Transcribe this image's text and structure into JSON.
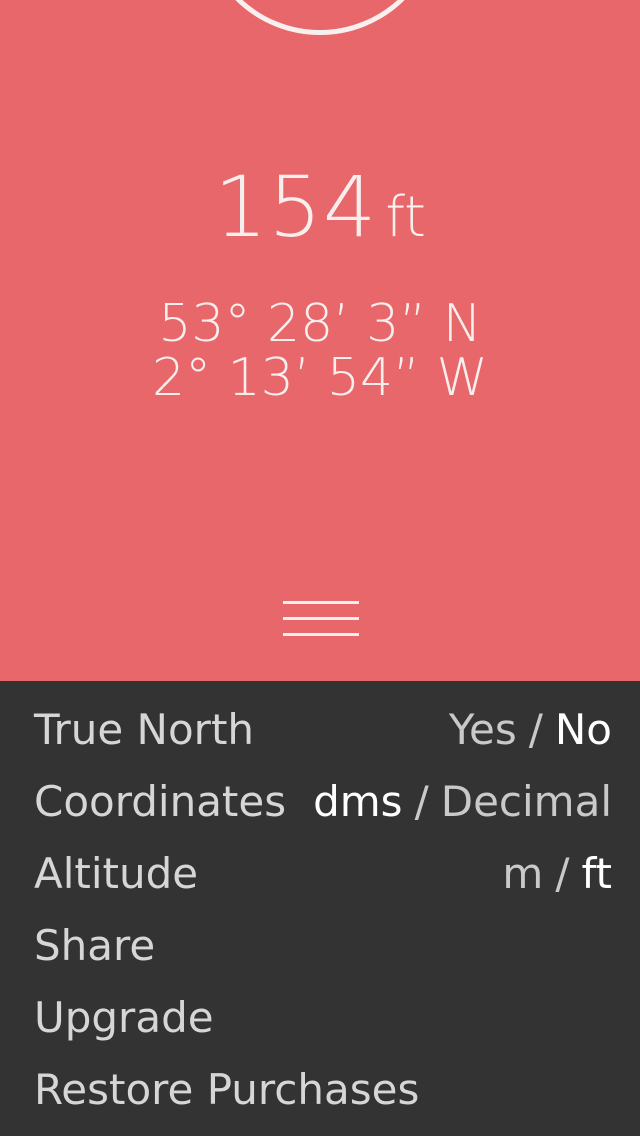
{
  "altitude": {
    "value": "154",
    "unit": "ft"
  },
  "coordinates": {
    "latitude": "53° 28’ 3” N",
    "longitude": "2° 13’ 54” W"
  },
  "menu_icon": "hamburger-menu-icon",
  "colors": {
    "accent": "#E8676A",
    "panel": "#333333",
    "text_light": "#F7EEEE",
    "option_active": "#FFFFFF",
    "option_inactive": "#C9C9C9"
  },
  "settings": {
    "true_north": {
      "label": "True North",
      "option_a": "Yes",
      "separator": "/",
      "option_b": "No",
      "selected": "No"
    },
    "coordinates": {
      "label": "Coordinates",
      "option_a": "dms",
      "separator": "/",
      "option_b": "Decimal",
      "selected": "dms"
    },
    "altitude": {
      "label": "Altitude",
      "option_a": "m",
      "separator": "/",
      "option_b": "ft",
      "selected": "ft"
    },
    "share": {
      "label": "Share"
    },
    "upgrade": {
      "label": "Upgrade"
    },
    "restore": {
      "label": "Restore Purchases"
    }
  }
}
